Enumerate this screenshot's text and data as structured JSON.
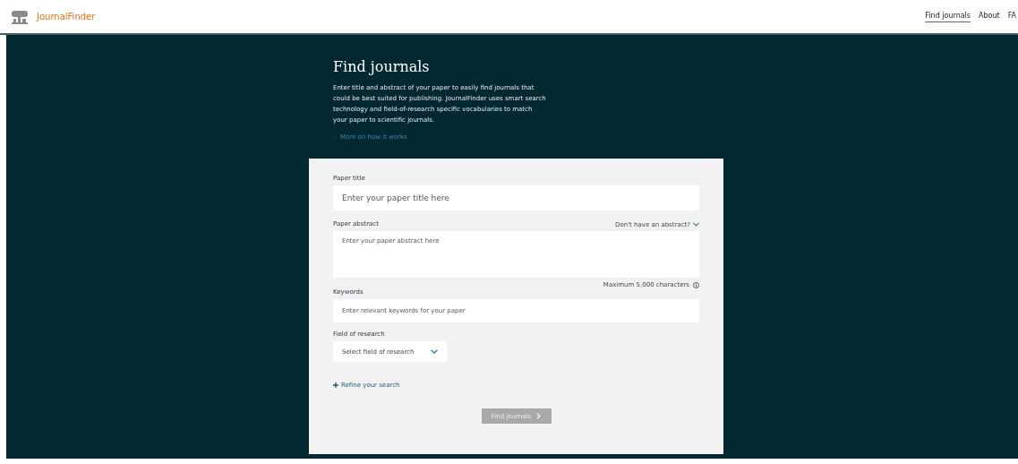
{
  "header": {
    "brand": "JournalFinder",
    "nav": [
      {
        "label": "Find journals",
        "selected": true
      },
      {
        "label": "About",
        "selected": false
      },
      {
        "label": "FA",
        "selected": false
      }
    ]
  },
  "intro": {
    "title": "Find journals",
    "description": "Enter title and abstract of your paper to easily find journals that could be best suited for publishing. JournalFinder uses smart search technology and field-of-research specific vocabularies to match your paper to scientific journals.",
    "link": "More on how it works"
  },
  "form": {
    "title_field": {
      "label": "Paper title",
      "placeholder": "Enter your paper title here"
    },
    "abstract_field": {
      "label": "Paper abstract",
      "toggle": "Don't have an abstract?",
      "placeholder": "Enter your paper abstract here",
      "hint": "Maximum 5,000 characters"
    },
    "keywords_field": {
      "label": "Keywords",
      "placeholder": "Enter relevant keywords for your paper"
    },
    "research_field": {
      "label": "Field of research",
      "placeholder": "Select field of research"
    },
    "refine_link": "Refine your search",
    "submit": {
      "label": "Find journals",
      "disabled": true
    }
  }
}
